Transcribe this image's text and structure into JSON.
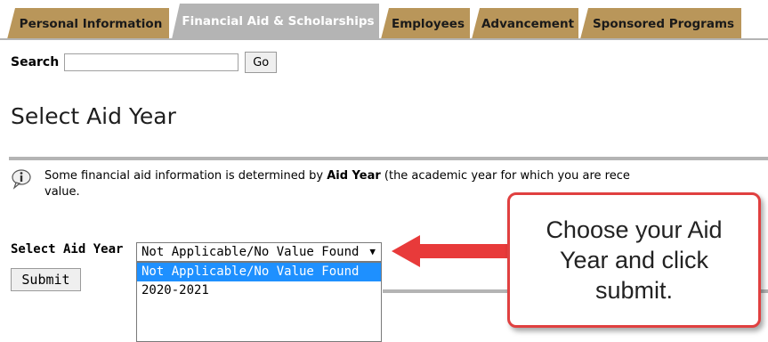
{
  "tabs": [
    {
      "label": "Personal Information",
      "active": false
    },
    {
      "label": "Financial Aid & Scholarships",
      "active": true
    },
    {
      "label": "Employees",
      "active": false
    },
    {
      "label": "Advancement",
      "active": false
    },
    {
      "label": "Sponsored Programs",
      "active": false
    }
  ],
  "search": {
    "label": "Search",
    "value": "",
    "go_label": "Go"
  },
  "page": {
    "title": "Select Aid Year"
  },
  "info": {
    "text_before": "Some financial aid information is determined by ",
    "bold": "Aid Year",
    "text_after": " (the academic year for which you are rece",
    "line2": "value."
  },
  "aid_year": {
    "label": "Select Aid Year",
    "selected": "Not Applicable/No Value Found",
    "options": [
      "Not Applicable/No Value Found",
      "2020-2021"
    ]
  },
  "submit_label": "Submit",
  "callout": {
    "text": "Choose your Aid Year and click submit."
  },
  "colors": {
    "tab": "#b9965a",
    "tab_active": "#b4b4b4",
    "highlight": "#1e90ff",
    "callout_border": "#e04040"
  }
}
